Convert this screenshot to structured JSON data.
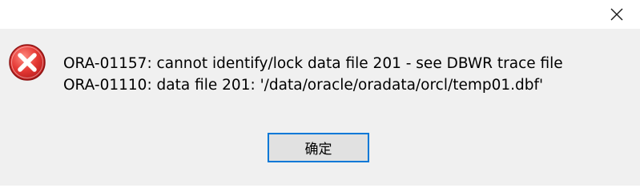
{
  "dialog": {
    "title": "",
    "close_icon": "close-icon",
    "error_icon": "error-icon",
    "message_lines": [
      "ORA-01157: cannot identify/lock data file 201 - see DBWR trace file",
      "ORA-01110: data file 201: '/data/oracle/oradata/orcl/temp01.dbf'"
    ],
    "ok_label": "确定",
    "accent_color": "#0078d7",
    "error_color": "#d32f2f"
  }
}
